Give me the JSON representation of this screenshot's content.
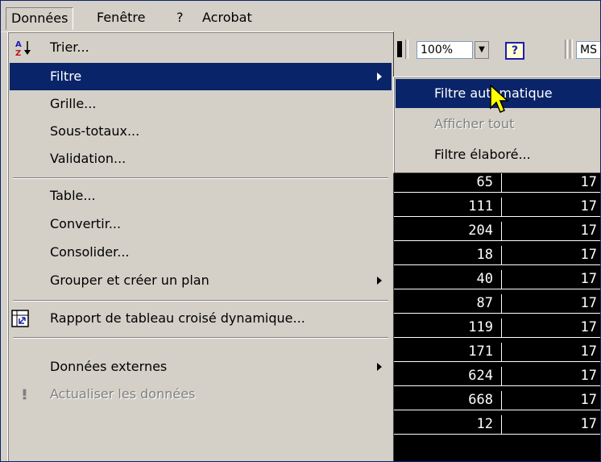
{
  "menubar": {
    "items": [
      {
        "label": "Données"
      },
      {
        "label": "Fenêtre"
      },
      {
        "label": "?"
      },
      {
        "label": "Acrobat"
      }
    ]
  },
  "toolbar": {
    "zoom": "100%",
    "help": "?",
    "font": "MS"
  },
  "data_menu": {
    "items": [
      {
        "label": "Trier...",
        "icon": "sort-az-icon"
      },
      {
        "label": "Filtre",
        "submenu": true
      },
      {
        "label": "Grille..."
      },
      {
        "label": "Sous-totaux..."
      },
      {
        "label": "Validation..."
      },
      {
        "label": "Table..."
      },
      {
        "label": "Convertir..."
      },
      {
        "label": "Consolider..."
      },
      {
        "label": "Grouper et créer un plan",
        "submenu": true
      },
      {
        "label": "Rapport de tableau croisé dynamique...",
        "icon": "pivot-table-icon"
      },
      {
        "label": "Données externes",
        "submenu": true
      },
      {
        "label": "Actualiser les données",
        "disabled": true,
        "icon": "refresh-exclamation-icon"
      }
    ]
  },
  "filter_submenu": {
    "items": [
      {
        "label": "Filtre automatique"
      },
      {
        "label": "Afficher tout",
        "disabled": true
      },
      {
        "label": "Filtre élaboré..."
      }
    ]
  },
  "sheet": {
    "rows": [
      {
        "a": "65",
        "b": "17"
      },
      {
        "a": "111",
        "b": "17"
      },
      {
        "a": "204",
        "b": "17"
      },
      {
        "a": "18",
        "b": "17"
      },
      {
        "a": "40",
        "b": "17"
      },
      {
        "a": "87",
        "b": "17"
      },
      {
        "a": "119",
        "b": "17"
      },
      {
        "a": "171",
        "b": "17"
      },
      {
        "a": "624",
        "b": "17"
      },
      {
        "a": "668",
        "b": "17"
      },
      {
        "a": "12",
        "b": "17"
      }
    ]
  },
  "colors": {
    "menu_face": "#d4d0c8",
    "highlight": "#0a246a",
    "sheet_bg": "#000000"
  }
}
